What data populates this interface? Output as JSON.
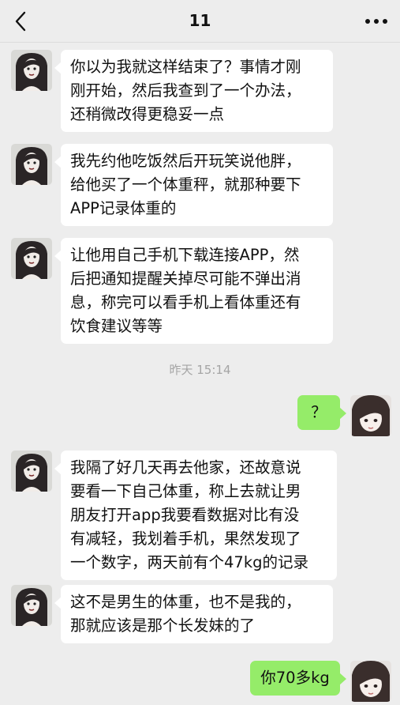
{
  "header": {
    "title": "11",
    "back_icon": "chevron-left-icon",
    "more_icon": "more-dots-icon"
  },
  "colors": {
    "background": "#ededed",
    "incoming_bubble": "#ffffff",
    "outgoing_bubble": "#95ec69",
    "timestamp_text": "#a5a5a5"
  },
  "messages": [
    {
      "sender": "other",
      "text": "你以为我就这样结束了？事情才刚\n刚开始，然后我查到了一个办法，\n还稍微改得更稳妥一点"
    },
    {
      "sender": "other",
      "text": "我先约他吃饭然后开玩笑说他胖，\n给他买了一个体重秤，就那种要下\nAPP记录体重的"
    },
    {
      "sender": "other",
      "text": "让他用自己手机下载连接APP，然\n后把通知提醒关掉尽可能不弹出消\n息，称完可以看手机上看体重还有\n饮食建议等等"
    },
    {
      "sender": "self",
      "text": "？"
    },
    {
      "sender": "other",
      "text": "我隔了好几天再去他家，还故意说\n要看一下自己体重，称上去就让男\n朋友打开app我要看数据对比有没\n有减轻，我划着手机，果然发现了\n一个数字，两天前有个47kg的记录"
    },
    {
      "sender": "other",
      "text": "这不是男生的体重，也不是我的，\n那就应该是那个长发妹的了"
    },
    {
      "sender": "self",
      "text": "你70多kg"
    }
  ],
  "timestamp": "昨天 15:14"
}
